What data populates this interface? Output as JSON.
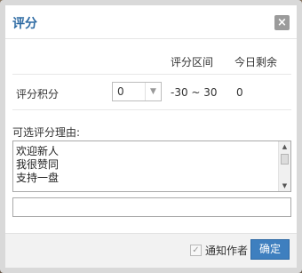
{
  "dialog": {
    "title": "评分",
    "close_label": "×"
  },
  "score_table": {
    "headers": [
      "评分区间",
      "今日剩余"
    ],
    "row": {
      "label": "评分积分",
      "selected_value": "0",
      "range": "-30 ~ 30",
      "remaining": "0"
    }
  },
  "reasons": {
    "label": "可选评分理由:",
    "options": [
      "欢迎新人",
      "我很赞同",
      "支持一盘"
    ],
    "input_value": ""
  },
  "footer": {
    "notify_label": "通知作者",
    "notify_checked": true,
    "confirm_label": "确定"
  },
  "colors": {
    "title": "#2d6aa3",
    "confirm_button": "#3e7fbf",
    "close_button": "#9b9b9b"
  }
}
